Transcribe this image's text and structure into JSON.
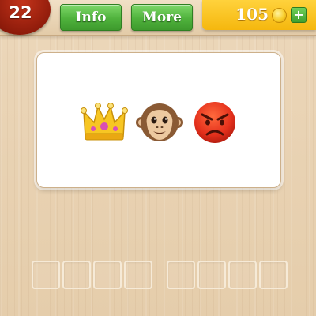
{
  "header": {
    "level": "22",
    "info_label": "Info",
    "more_label": "More",
    "coins": "105",
    "add_coins_label": "+"
  },
  "puzzle": {
    "emojis": [
      "crown-icon",
      "monkey-face-icon",
      "angry-face-icon"
    ]
  },
  "answer": {
    "word_lengths": [
      4,
      4
    ],
    "letters": [
      "",
      "",
      "",
      "",
      "",
      "",
      "",
      ""
    ]
  },
  "colors": {
    "level_badge": "#9a220f",
    "button_green": "#4fb23c",
    "coin_panel": "#f5b70e",
    "wood": "#e9d3b4"
  }
}
